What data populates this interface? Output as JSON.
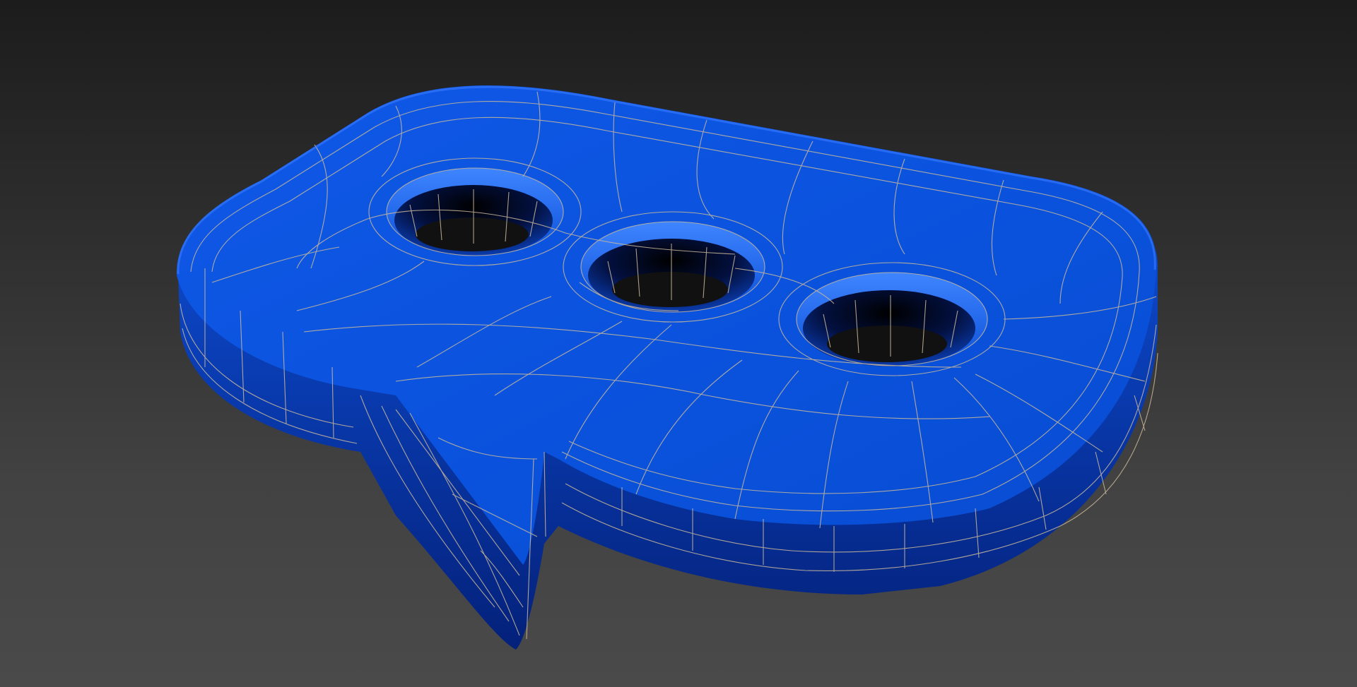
{
  "viewport": {
    "background_top": "#1c1c1c",
    "background_bottom": "#4a4a4a"
  },
  "model": {
    "object": "speech-bubble",
    "surface_color": "#0a4fd8",
    "surface_dark": "#05258a",
    "wireframe_color": "#c9b89a",
    "hole_count": 3
  }
}
